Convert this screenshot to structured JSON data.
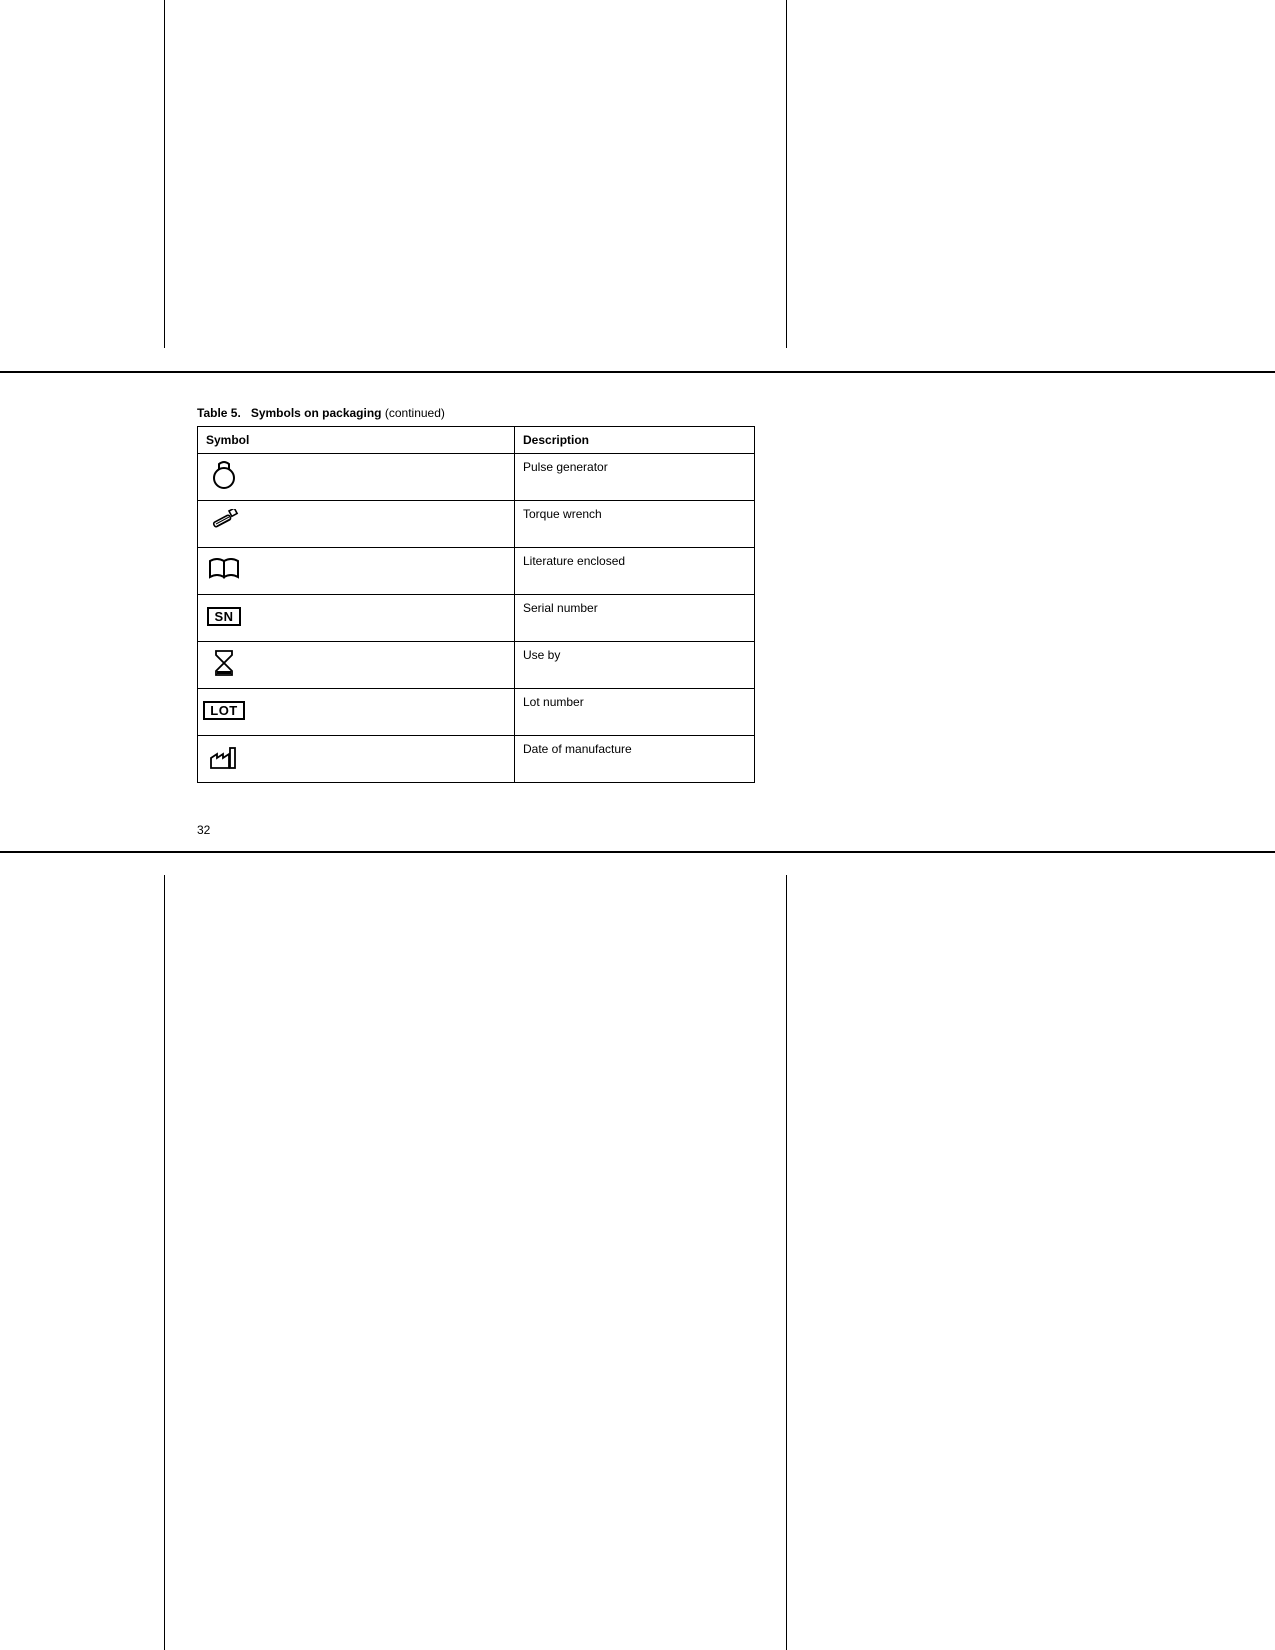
{
  "caption": {
    "label": "Table 5.",
    "title": "Symbols on packaging",
    "suffix": "(continued)"
  },
  "table": {
    "headers": {
      "symbol": "Symbol",
      "description": "Description"
    },
    "rows": [
      {
        "icon": "pulse-generator-icon",
        "description": "Pulse generator"
      },
      {
        "icon": "torque-wrench-icon",
        "description": "Torque wrench"
      },
      {
        "icon": "book-icon",
        "description": "Literature enclosed"
      },
      {
        "icon": "sn-box-icon",
        "box_text": "SN",
        "description": "Serial number"
      },
      {
        "icon": "hourglass-icon",
        "description": "Use by"
      },
      {
        "icon": "lot-box-icon",
        "box_text": "LOT",
        "description": "Lot number"
      },
      {
        "icon": "factory-icon",
        "description": "Date of manufacture"
      }
    ]
  },
  "page_number": "32"
}
